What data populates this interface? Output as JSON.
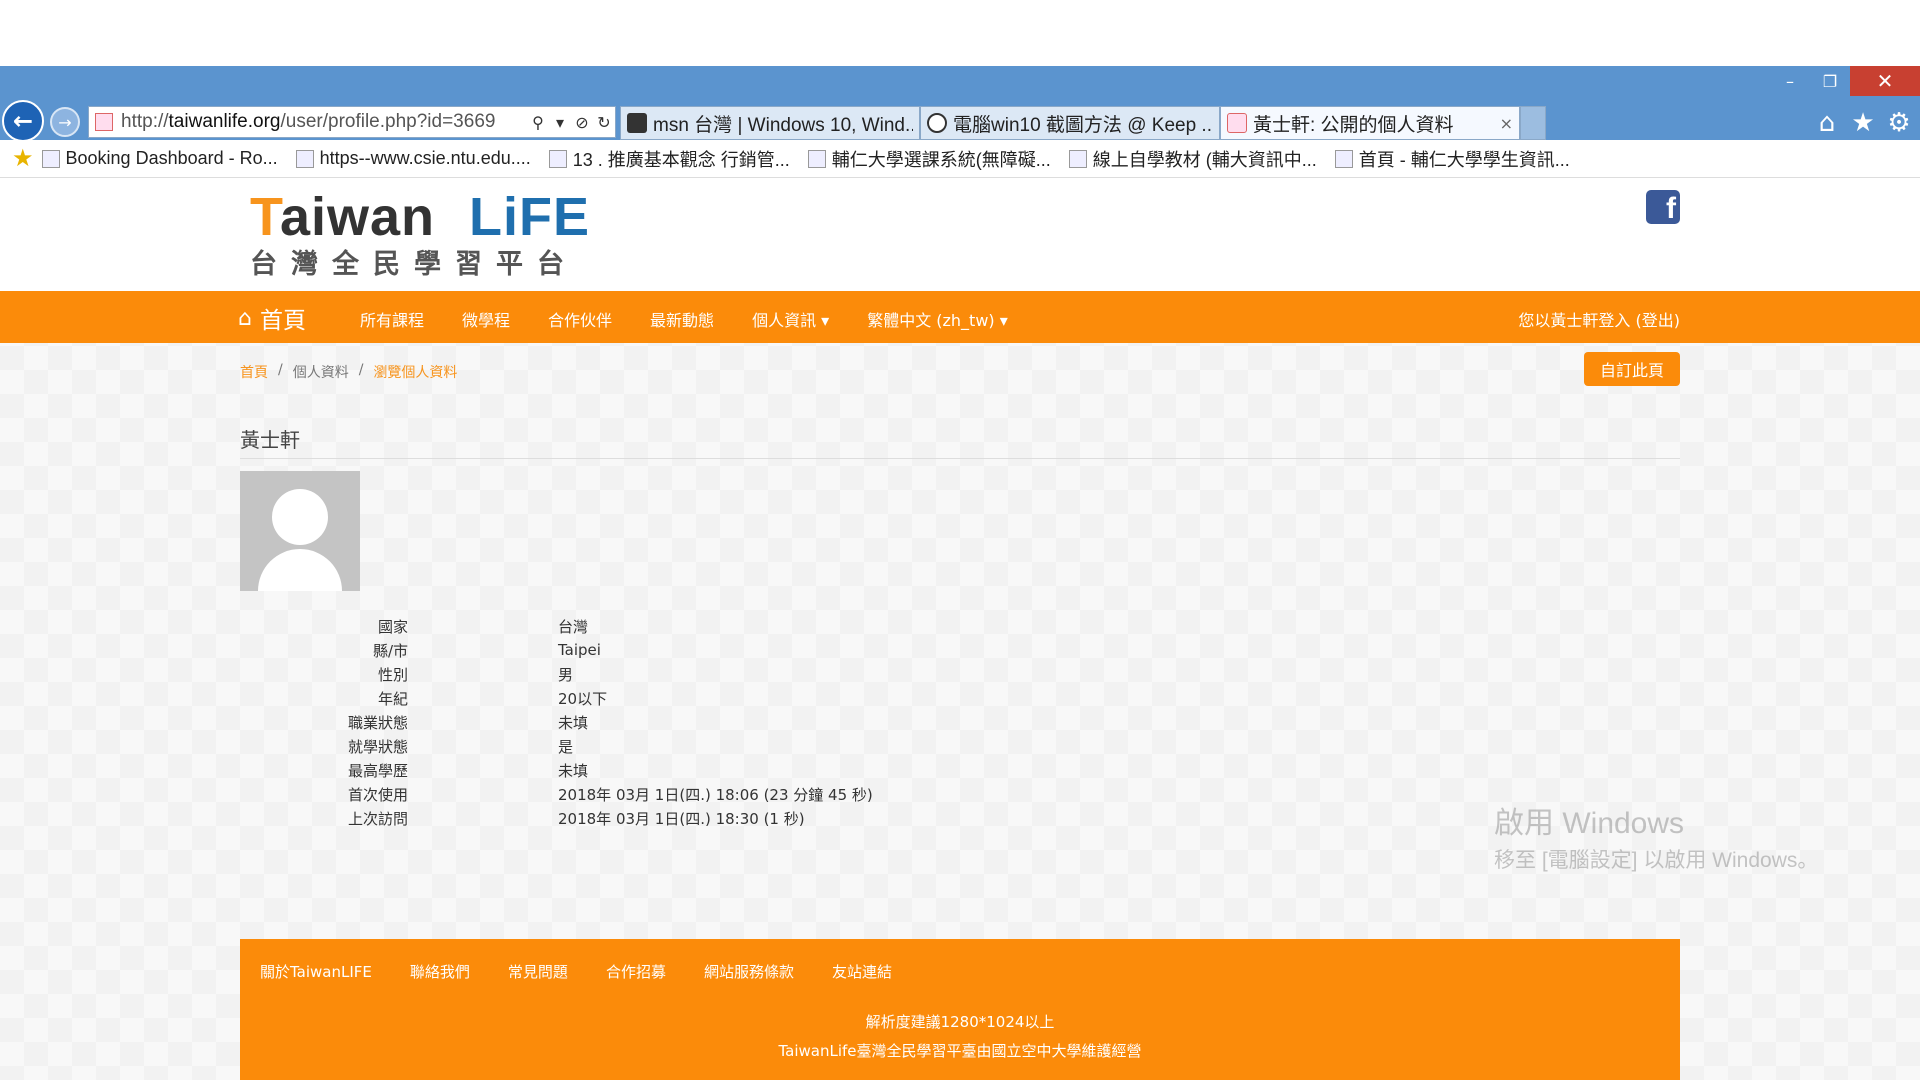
{
  "browser": {
    "window_controls": {
      "minimize": "–",
      "restore": "❐",
      "close": "✕"
    },
    "back_icon": "←",
    "forward_icon": "→",
    "address": {
      "prefix": "http://",
      "domain": "taiwanlife.org",
      "path": "/user/profile.php?id=3669"
    },
    "tabs": [
      {
        "label": "msn 台灣 | Windows 10, Wind...",
        "active": false
      },
      {
        "label": "電腦win10 截圖方法 @ Keep ...",
        "active": false
      },
      {
        "label": "黃士軒: 公開的個人資料",
        "active": true
      }
    ],
    "tab_close": "×",
    "tool_icons": {
      "home": "⌂",
      "favorites": "★",
      "settings": "⚙"
    },
    "favorites_bar": [
      "Booking Dashboard - Ro...",
      "https--www.csie.ntu.edu....",
      "13 . 推廣基本觀念 行銷管...",
      "輔仁大學選課系統(無障礙...",
      "線上自學教材 (輔大資訊中...",
      "首頁 - 輔仁大學學生資訊..."
    ]
  },
  "site": {
    "logo": {
      "taiwan_first": "T",
      "taiwan_rest": "aiwan",
      "life": "LiFE",
      "subtitle": "台灣全民學習平台"
    },
    "facebook_icon": "f",
    "nav": {
      "home": "首頁",
      "items": [
        "所有課程",
        "微學程",
        "合作伙伴",
        "最新動態",
        "個人資訊 ▾",
        "繁體中文 (zh_tw) ▾"
      ],
      "user": "您以黃士軒登入 (登出)"
    },
    "breadcrumb": [
      "首頁",
      "/",
      "個人資料",
      "/",
      "瀏覽個人資料"
    ],
    "customize_button": "自訂此頁"
  },
  "profile": {
    "name": "黃士軒",
    "rows": [
      {
        "label": "國家",
        "value": "台灣"
      },
      {
        "label": "縣/市",
        "value": "Taipei"
      },
      {
        "label": "性別",
        "value": "男"
      },
      {
        "label": "年紀",
        "value": "20以下"
      },
      {
        "label": "職業狀態",
        "value": "未填"
      },
      {
        "label": "就學狀態",
        "value": "是"
      },
      {
        "label": "最高學歷",
        "value": "未填"
      },
      {
        "label": "首次使用",
        "value": "2018年 03月 1日(四.) 18:06  (23 分鐘 45 秒)"
      },
      {
        "label": "上次訪問",
        "value": "2018年 03月 1日(四.) 18:30  (1 秒)"
      }
    ]
  },
  "footer": {
    "links": [
      "關於TaiwanLIFE",
      "聯絡我們",
      "常見問題",
      "合作招募",
      "網站服務條款",
      "友站連結"
    ],
    "line1": "解析度建議1280*1024以上",
    "line2": "TaiwanLife臺灣全民學習平臺由國立空中大學維護經營"
  },
  "watermark": {
    "line1": "啟用 Windows",
    "line2": "移至 [電腦設定] 以啟用 Windows。"
  },
  "colors": {
    "accent": "#fb8b0a",
    "chrome": "#5b94cf",
    "link": "#f7941d"
  }
}
